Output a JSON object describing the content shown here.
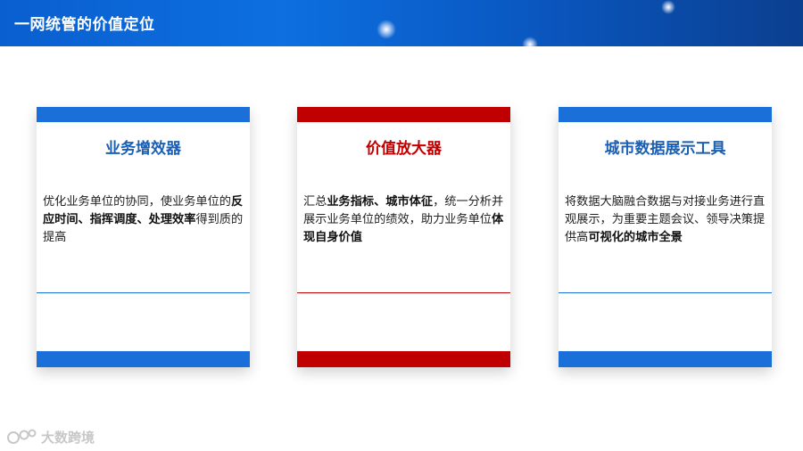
{
  "header": {
    "title": "一网统管的价值定位"
  },
  "cards": [
    {
      "title": "业务增效器",
      "body": [
        {
          "t": "优化业务单位的协同，使业务单位的",
          "b": false
        },
        {
          "t": "反应时间、指挥调度、处理效率",
          "b": true
        },
        {
          "t": "得到质的提高",
          "b": false
        }
      ]
    },
    {
      "title": "价值放大器",
      "body": [
        {
          "t": "汇总",
          "b": false
        },
        {
          "t": "业务指标、城市体征",
          "b": true
        },
        {
          "t": "，统一分析并展示业务单位的绩效，助力业务单位",
          "b": false
        },
        {
          "t": "体现自身价值",
          "b": true
        }
      ]
    },
    {
      "title": "城市数据展示工具",
      "body": [
        {
          "t": "将数据大脑融合数据与对接业务进行直观展示，为重要主题会议、领导决策提供高",
          "b": false
        },
        {
          "t": "可视化的城市全景",
          "b": true
        }
      ]
    }
  ],
  "watermark": {
    "text": "大数跨境",
    "icon": "brand-logo-icon"
  },
  "colors": {
    "header": "#0a5fcf",
    "blue": "#1a6fd8",
    "red": "#c00000"
  }
}
